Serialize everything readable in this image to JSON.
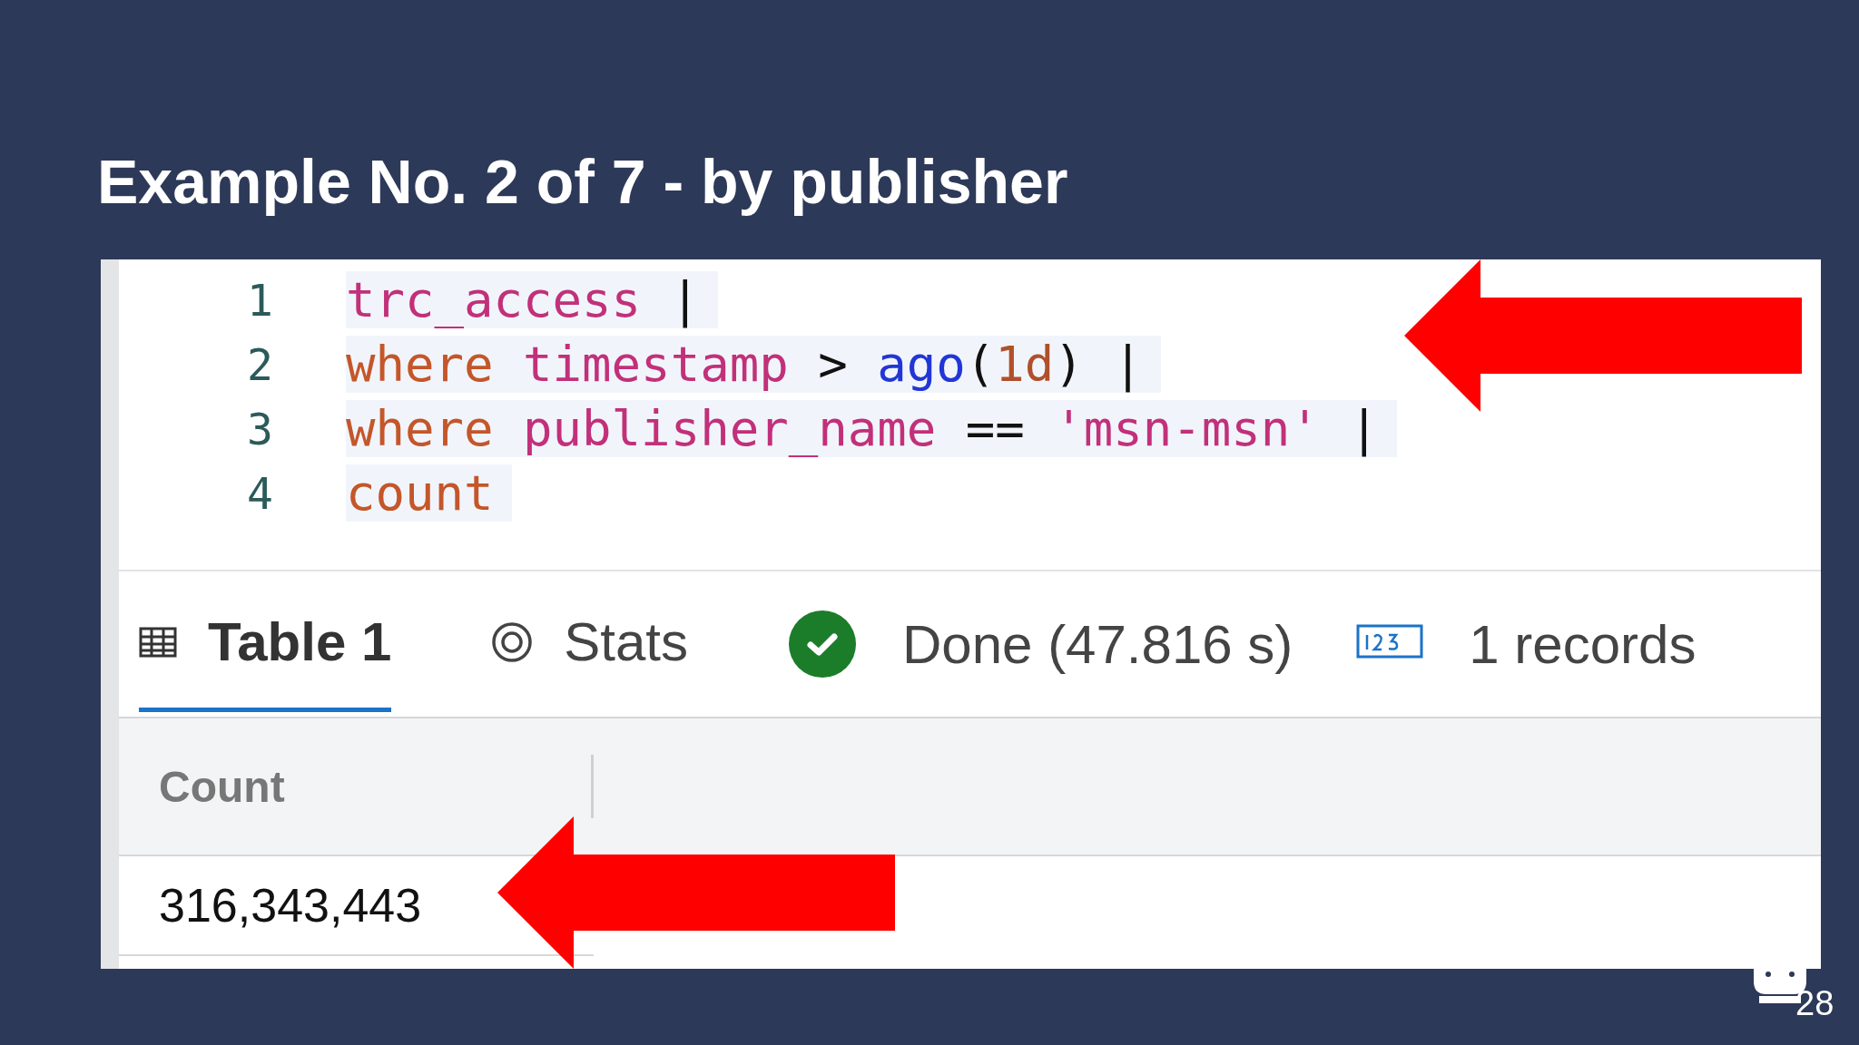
{
  "slide": {
    "title": "Example No. 2 of 7 - by publisher",
    "page_number": "28"
  },
  "editor": {
    "lines": [
      {
        "number": "1",
        "tokens": [
          {
            "text": "trc_access",
            "kind": "ident"
          },
          {
            "text": " |",
            "kind": "op"
          }
        ]
      },
      {
        "number": "2",
        "tokens": [
          {
            "text": "where",
            "kind": "keyword"
          },
          {
            "text": " timestamp",
            "kind": "ident"
          },
          {
            "text": " > ",
            "kind": "op"
          },
          {
            "text": "ago",
            "kind": "func"
          },
          {
            "text": "(",
            "kind": "op"
          },
          {
            "text": "1d",
            "kind": "number"
          },
          {
            "text": ") |",
            "kind": "op"
          }
        ]
      },
      {
        "number": "3",
        "tokens": [
          {
            "text": "where",
            "kind": "keyword"
          },
          {
            "text": " publisher_name",
            "kind": "ident"
          },
          {
            "text": " == ",
            "kind": "op"
          },
          {
            "text": "'msn-msn'",
            "kind": "string"
          },
          {
            "text": " |",
            "kind": "op"
          }
        ]
      },
      {
        "number": "4",
        "tokens": [
          {
            "text": "count",
            "kind": "keyword"
          }
        ]
      }
    ]
  },
  "results": {
    "tabs": [
      {
        "label": "Table 1",
        "kind": "table",
        "selected": true
      },
      {
        "label": "Stats",
        "kind": "stats",
        "selected": false
      }
    ],
    "status": "Done (47.816 s)",
    "records": "1 records",
    "table": {
      "columns": [
        "Count"
      ],
      "rows": [
        [
          "316,343,443"
        ]
      ]
    }
  }
}
